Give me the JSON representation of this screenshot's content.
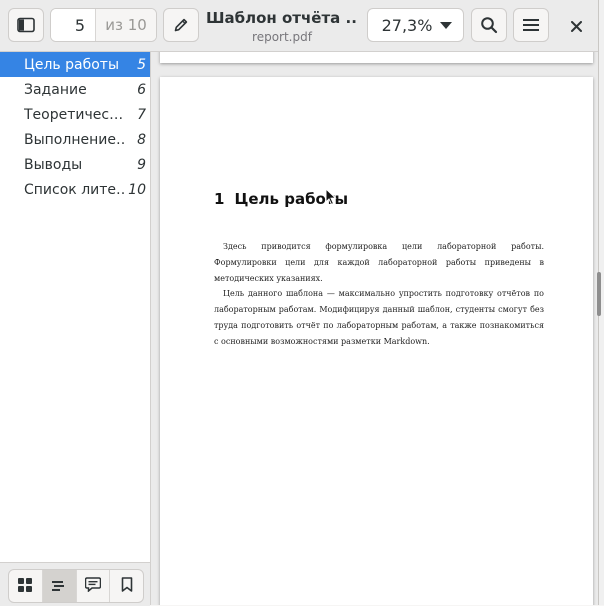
{
  "header": {
    "sidebar_toggle_icon": "sidebar-toggle-icon",
    "page_number": "5",
    "page_total": "из 10",
    "annotate_icon": "pencil-icon",
    "title": "Шаблон отчёта ...",
    "subtitle": "report.pdf",
    "zoom": "27,3%",
    "search_icon": "search-icon",
    "menu_icon": "hamburger-menu-icon",
    "close_icon": "close-icon"
  },
  "sidebar": {
    "items": [
      {
        "title": "Цель работы",
        "page": "5",
        "selected": true
      },
      {
        "title": "Задание",
        "page": "6",
        "selected": false
      },
      {
        "title": "Теоретичес…",
        "page": "7",
        "selected": false
      },
      {
        "title": "Выполнение…",
        "page": "8",
        "selected": false
      },
      {
        "title": "Выводы",
        "page": "9",
        "selected": false
      },
      {
        "title": "Список лите…",
        "page": "10",
        "selected": false
      }
    ],
    "modes": [
      "thumbnails-icon",
      "outline-icon",
      "annotations-icon",
      "bookmarks-icon"
    ],
    "active_mode": "outline-icon"
  },
  "document": {
    "heading_number": "1",
    "heading_text": "Цель работы",
    "paragraphs": [
      "Здесь приводится формулировка цели лабораторной работы. Формулировки цели для каждой лабораторной работы приведены в методических указаниях.",
      "Цель данного шаблона — максимально упростить подготовку отчётов по лабораторным работам. Модифицируя данный шаблон, студенты смогут без труда подготовить отчёт по лабораторным работам, а также познакомиться с основными возможностями разметки Markdown."
    ]
  },
  "colors": {
    "accent": "#3584e4",
    "headerbar": "#ebebeb",
    "sidebar_bg": "#ffffff",
    "doc_bg": "#ebebeb"
  }
}
